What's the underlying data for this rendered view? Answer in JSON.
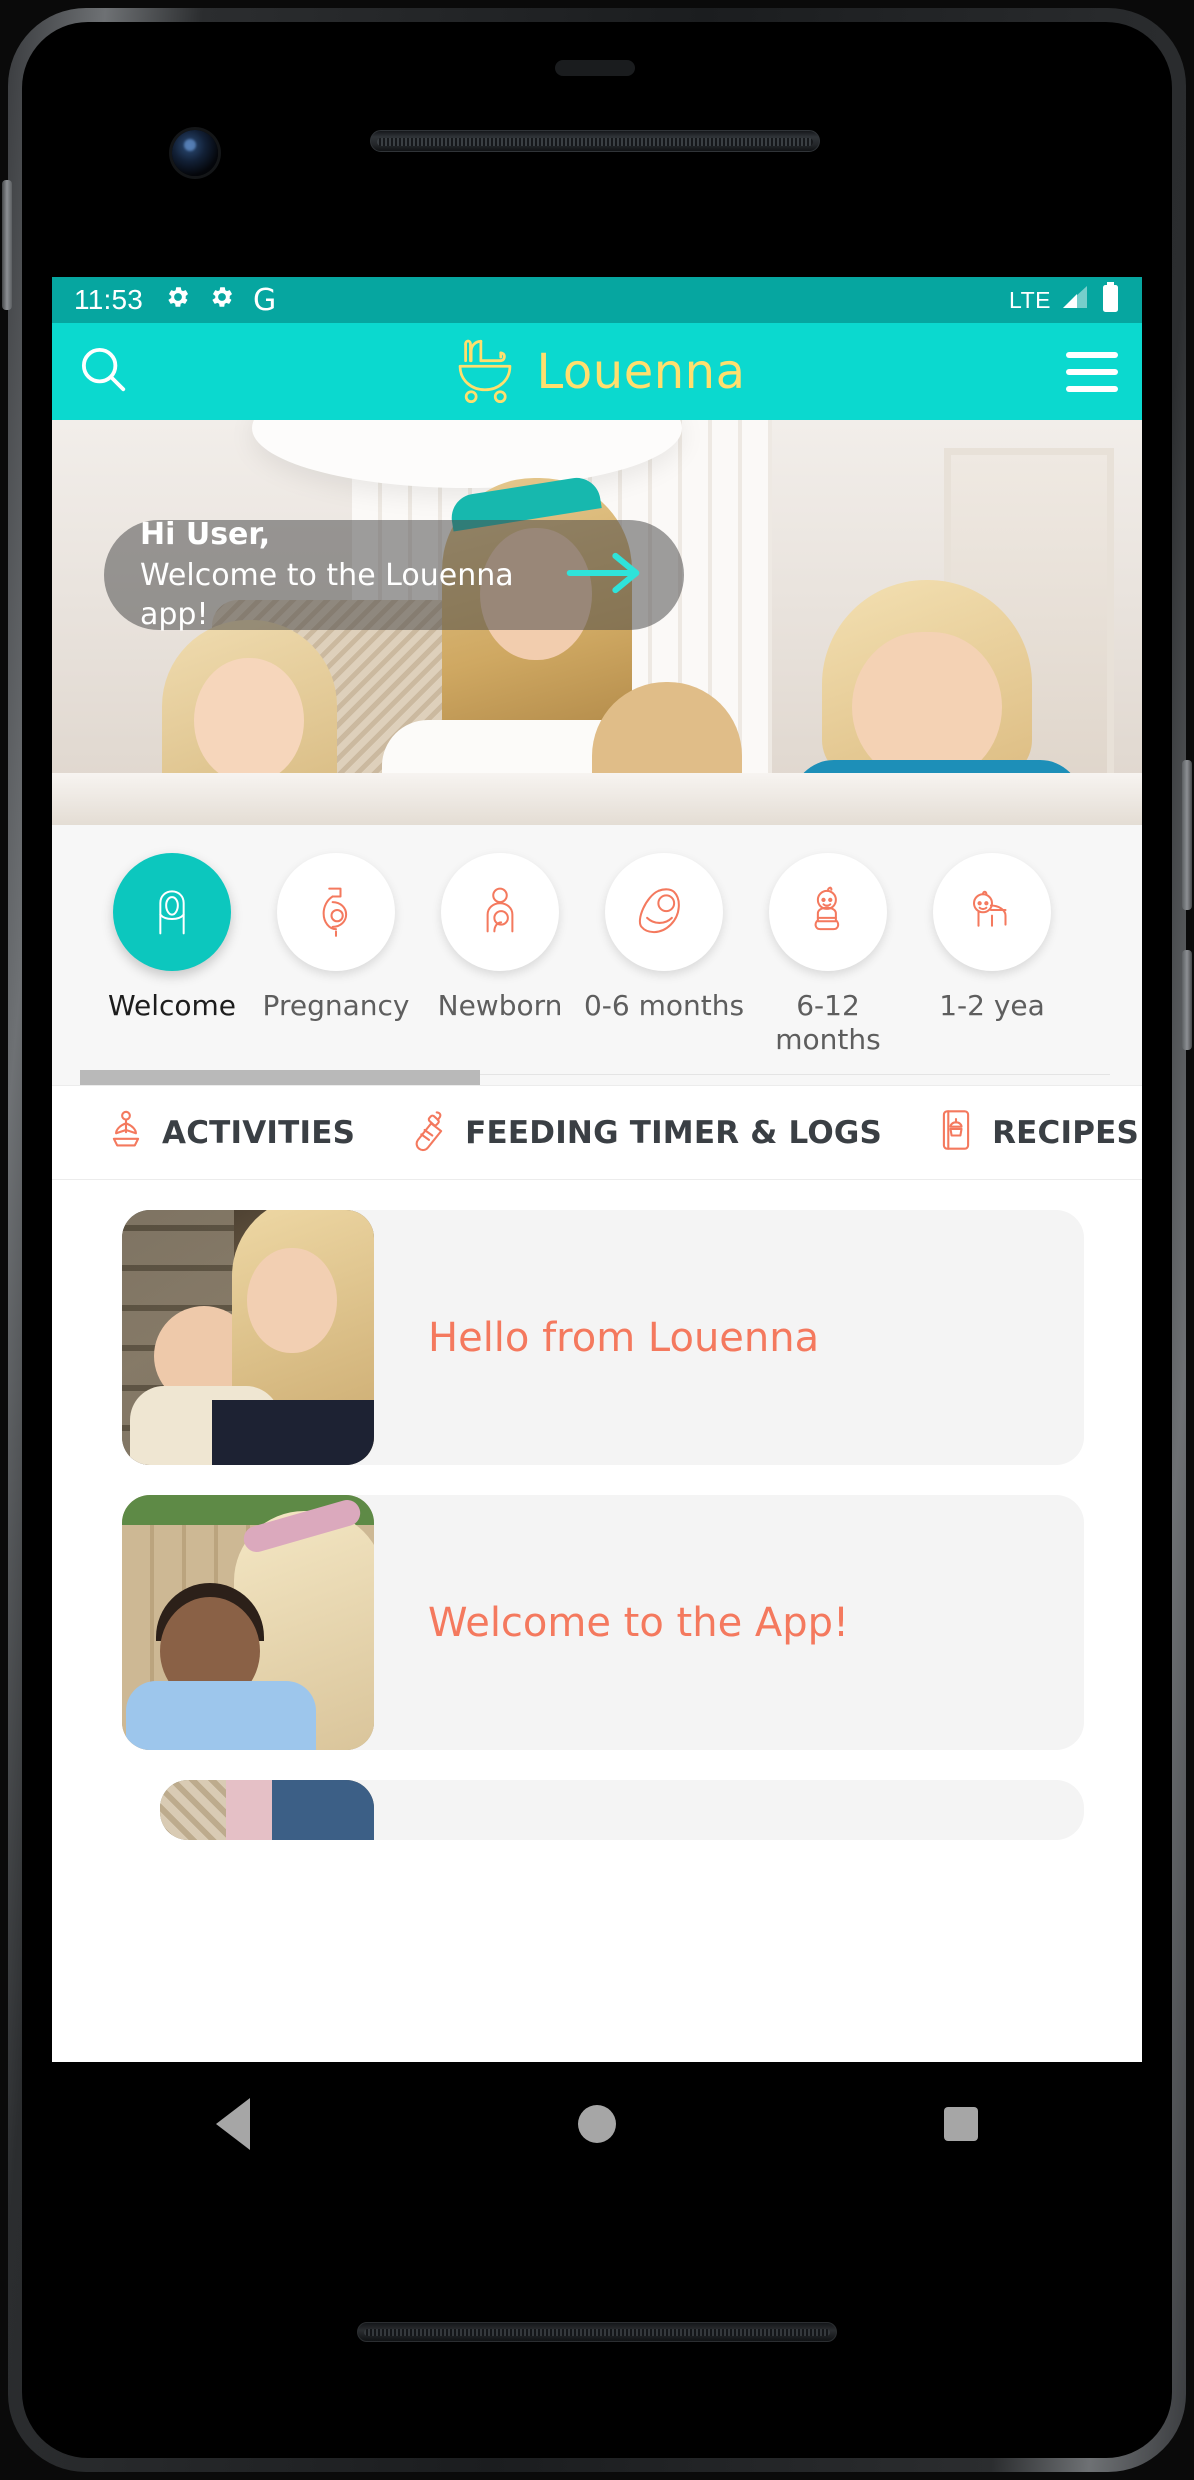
{
  "statusbar": {
    "time": "11:53",
    "icons_left": [
      "gear-icon",
      "gear-icon",
      "google-g-icon"
    ],
    "network": "LTE",
    "signal_icon": "signal-bars-icon",
    "battery_icon": "battery-full-icon"
  },
  "appbar": {
    "search_icon": "search-icon",
    "logo_icon": "pram-logo-icon",
    "brand": "Louenna",
    "menu_icon": "hamburger-menu-icon",
    "bg_color": "#0bd9cf",
    "brand_color": "#ffdf6e"
  },
  "hero": {
    "greeting": "Hi User,",
    "subtitle": "Welcome to the Louenna app!",
    "arrow_icon": "arrow-right-icon",
    "arrow_color": "#2fe3da"
  },
  "categories": {
    "active_index": 0,
    "items": [
      {
        "label": "Welcome",
        "icon": "pregnant-woman-portrait-icon",
        "active": true
      },
      {
        "label": "Pregnancy",
        "icon": "pregnant-belly-icon",
        "active": false
      },
      {
        "label": "Newborn",
        "icon": "mother-holding-newborn-icon",
        "active": false
      },
      {
        "label": "0-6 months",
        "icon": "swaddled-baby-icon",
        "active": false
      },
      {
        "label": "6-12\nmonths",
        "icon": "sitting-baby-icon",
        "active": false
      },
      {
        "label": "1-2 yea",
        "icon": "crawling-baby-icon",
        "active": false
      }
    ],
    "active_color": "#0cc7be",
    "icon_color": "#f4795e"
  },
  "tabs": [
    {
      "label": "ACTIVITIES",
      "icon": "yoga-lotus-icon"
    },
    {
      "label": "FEEDING TIMER & LOGS",
      "icon": "baby-bottle-icon"
    },
    {
      "label": "RECIPES",
      "icon": "recipe-book-icon"
    },
    {
      "label": "",
      "icon": "first-aid-kit-icon"
    }
  ],
  "cards": [
    {
      "title": "Hello from Louenna",
      "thumb": "mother-and-baby-indoor-photo"
    },
    {
      "title": "Welcome to the App!",
      "thumb": "mother-and-baby-outdoor-photo"
    },
    {
      "title": "",
      "thumb": "partial-card-photo"
    }
  ],
  "navbar": {
    "back": "back-triangle-icon",
    "home": "home-circle-icon",
    "recents": "recents-square-icon"
  }
}
